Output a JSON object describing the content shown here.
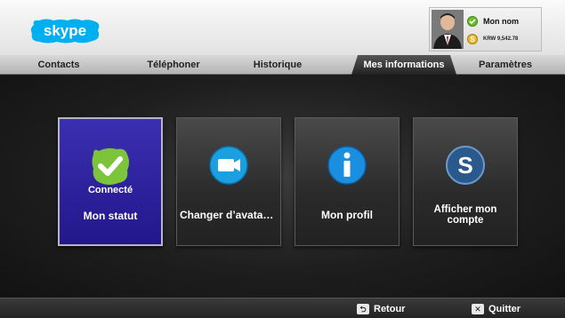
{
  "header": {
    "logo_text": "skype",
    "user": {
      "name": "Mon nom",
      "credit": "KRW 9,542.78"
    }
  },
  "tabs": [
    {
      "label": "Contacts",
      "active": false
    },
    {
      "label": "Téléphoner",
      "active": false
    },
    {
      "label": "Historique",
      "active": false
    },
    {
      "label": "Mes informations",
      "active": true
    },
    {
      "label": "Paramètres",
      "active": false
    }
  ],
  "tiles": [
    {
      "icon": "check-bubble-icon",
      "sub": "Connecté",
      "label": "Mon statut",
      "selected": true
    },
    {
      "icon": "camera-icon",
      "sub": "",
      "label": "Changer d’avatar…",
      "selected": false
    },
    {
      "icon": "info-icon",
      "sub": "",
      "label": "Mon profil",
      "selected": false
    },
    {
      "icon": "skype-icon",
      "sub": "",
      "label": "Afficher mon compte",
      "selected": false
    }
  ],
  "footer": {
    "back_label": "Retour",
    "quit_label": "Quitter"
  },
  "colors": {
    "selected_tile": "#2b1fa0",
    "status_online": "#6fbb2c",
    "skype_blue": "#00aff0"
  }
}
